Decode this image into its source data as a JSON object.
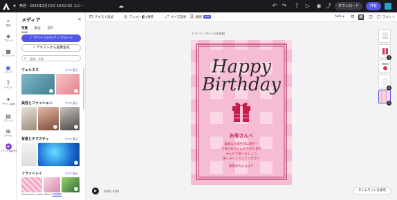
{
  "topbar": {
    "title": "無題 - 2025年3月15日 18:02:02 コピー",
    "download_label": "ダウンロード",
    "share_label": "共有"
  },
  "rail": {
    "items": [
      {
        "label": "検索",
        "icon": "search-icon"
      },
      {
        "label": "ブランド",
        "icon": "brand-icon"
      },
      {
        "label": "テンプレート",
        "icon": "template-icon"
      },
      {
        "label": "メディア",
        "icon": "media-icon"
      },
      {
        "label": "テキスト",
        "icon": "text-icon"
      },
      {
        "label": "デザイン素材",
        "icon": "elements-icon"
      },
      {
        "label": "グリッド",
        "icon": "grid-icon"
      },
      {
        "label": "アドオン",
        "icon": "addons-icon"
      },
      {
        "label": "ブランド素材を追加",
        "icon": "add-brand-icon"
      }
    ]
  },
  "panel": {
    "title": "メディア",
    "tabs": [
      "写真",
      "動画",
      "音声"
    ],
    "upload_label": "デバイスからアップロード",
    "generate_label": "テキストから画像生成",
    "search_placeholder": "画像、写真",
    "sections": [
      {
        "title": "ウェルネス",
        "see_all": "すべて表示"
      },
      {
        "title": "美容とファッション",
        "see_all": "すべて表示"
      },
      {
        "title": "背景とテクスチャ",
        "see_all": "すべて表示"
      },
      {
        "title": "フラットレイ",
        "see_all": "すべて表示"
      }
    ],
    "footer_prefix": "Powered by Adobe Stock",
    "footer_link": "利用規約"
  },
  "toolbar": {
    "items": [
      {
        "label": "テキスト追加",
        "icon": "text-add-icon"
      },
      {
        "label": "アニメーション",
        "icon": "animate-icon"
      },
      {
        "label": "背景",
        "icon": "background-icon"
      },
      {
        "label": "サイズ変更",
        "icon": "resize-icon"
      },
      {
        "label": "翻訳",
        "icon": "translate-icon"
      },
      {
        "label": "NEW",
        "icon": "new-badge"
      }
    ],
    "zoom": "56%",
    "comment_label": "コメント"
  },
  "canvas": {
    "page_label": "1 ページ - タイトルを追加",
    "card": {
      "title_line1": "Happy",
      "title_line2": "Birthday",
      "greeting": "お母さんへ",
      "message_lines": [
        "素敵なお誕生日に乾杯！",
        "今日はお母さんの大切な日を",
        "みんなで祝いましょう",
        "楽しみにしていてください"
      ],
      "signature": "家族のみんなより",
      "colors": {
        "pink": "#f9cde0",
        "stripe": "#f3a9c6",
        "frame": "#b02a5c",
        "gift": "#c71c4b"
      }
    }
  },
  "player": {
    "time": "0:00 / 0:00"
  },
  "timeline_label": "タイムラインを表示",
  "pages": [
    "1",
    "2",
    "3",
    "4",
    "5"
  ]
}
